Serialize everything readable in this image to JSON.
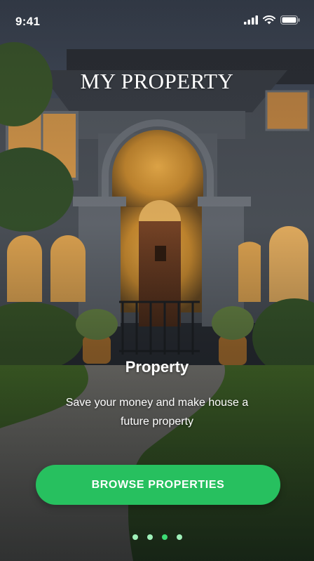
{
  "status_bar": {
    "time": "9:41",
    "icons": [
      "cellular-signal-icon",
      "wifi-icon",
      "battery-icon"
    ]
  },
  "app": {
    "title": "MY PROPERTY"
  },
  "slide": {
    "heading": "Property",
    "description": "Save your money and make house a future property"
  },
  "cta": {
    "label": "BROWSE PROPERTIES",
    "color": "#27c05f"
  },
  "pager": {
    "total": 4,
    "active_index": 2,
    "dot_color": "#9ff0b9",
    "active_color": "#3ddc75"
  },
  "background": {
    "image": "house-at-dusk-photo"
  }
}
